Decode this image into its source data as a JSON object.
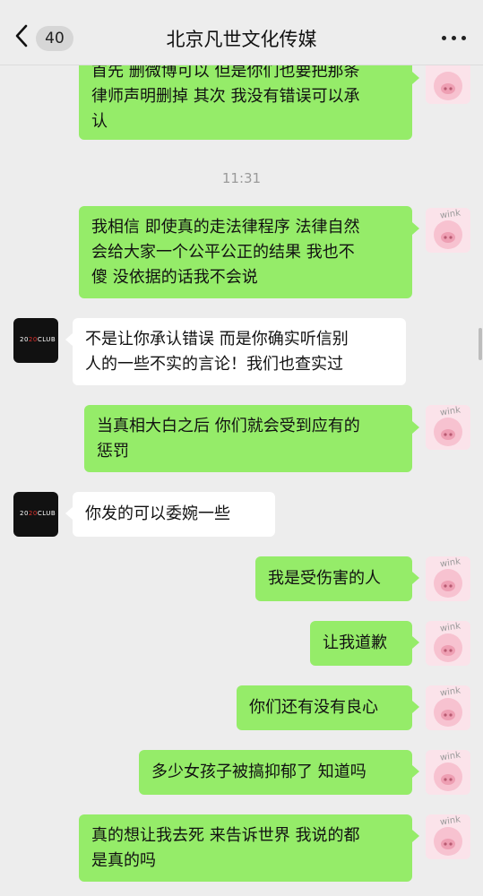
{
  "header": {
    "unread_count": "40",
    "title": "北京凡世文化传媒"
  },
  "chat": {
    "timestamp": "11:31",
    "my_avatar_label": "wink",
    "other_avatar_logo": "2020CLUB",
    "messages": [
      {
        "from": "me",
        "text": "首先 删微博可以 但是你们也要把那条\n律师声明删掉 其次 我没有错误可以承\n认"
      },
      {
        "from": "me",
        "text": "我相信 即使真的走法律程序 法律自然\n会给大家一个公平公正的结果 我也不\n傻 没依据的话我不会说"
      },
      {
        "from": "other",
        "text": "不是让你承认错误 而是你确实听信别\n人的一些不实的言论！我们也查实过"
      },
      {
        "from": "me",
        "text": "当真相大白之后 你们就会受到应有的\n惩罚"
      },
      {
        "from": "other",
        "text": "你发的可以委婉一些"
      },
      {
        "from": "me",
        "text": "我是受伤害的人"
      },
      {
        "from": "me",
        "text": "让我道歉"
      },
      {
        "from": "me",
        "text": "你们还有没有良心"
      },
      {
        "from": "me",
        "text": "多少女孩子被搞抑郁了 知道吗"
      },
      {
        "from": "me",
        "text": "真的想让我去死 来告诉世界 我说的都\n是真的吗"
      }
    ]
  },
  "colors": {
    "background": "#ededed",
    "outgoing_bubble": "#95ec69",
    "incoming_bubble": "#ffffff",
    "my_avatar_bg": "#fbe3ea",
    "other_avatar_bg": "#111111"
  },
  "icons": {
    "back": "chevron-left-icon",
    "more": "more-dots-icon"
  }
}
